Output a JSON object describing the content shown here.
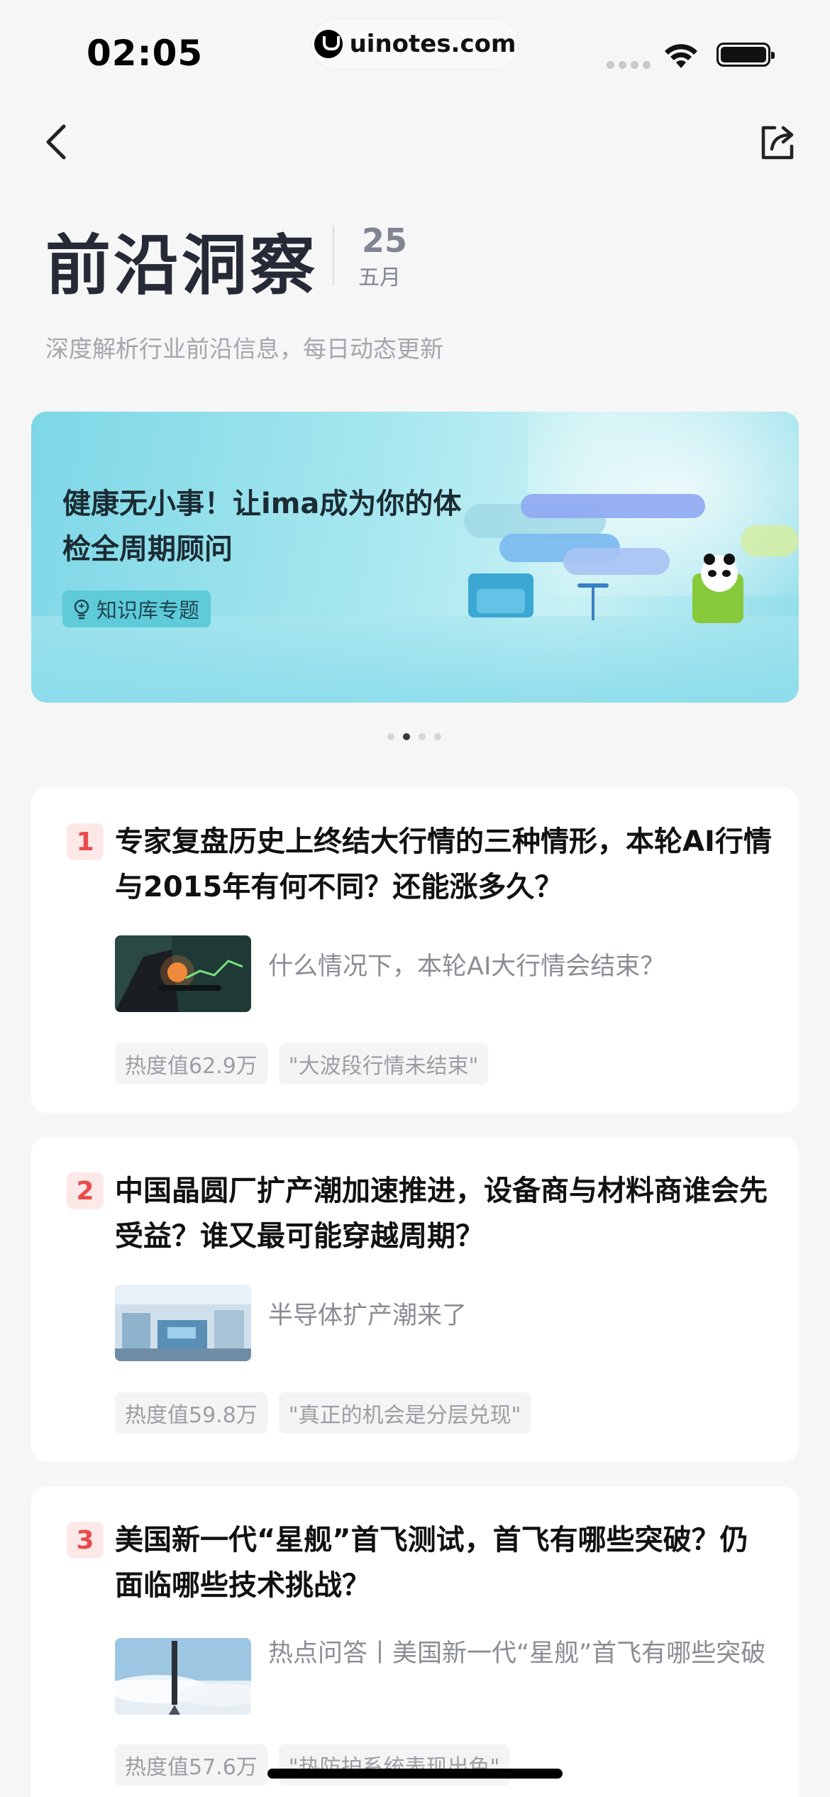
{
  "status_bar": {
    "time": "02:05",
    "url": "uinotes.com"
  },
  "nav": {
    "back_icon": "chevron-left-icon",
    "share_icon": "share-icon"
  },
  "header": {
    "title": "前沿洞察",
    "date_day": "25",
    "date_month": "五月",
    "subtitle": "深度解析行业前沿信息，每日动态更新"
  },
  "banner": {
    "title": "健康无小事！让ima成为你的体检全周期顾问",
    "tag": "知识库专题",
    "tag_icon": "lightbulb-icon",
    "colors": {
      "accent": "#5fcbd9",
      "background": "#a7e7ef"
    }
  },
  "carousel": {
    "count": 4,
    "active_index": 1
  },
  "articles": [
    {
      "rank": "1",
      "title": "专家复盘历史上终结大行情的三种情形，本轮AI行情与2015年有何不同？还能涨多久？",
      "desc": "什么情况下，本轮AI大行情会结束？",
      "heat": "热度值62.9万",
      "quote": "\"大波段行情未结束\"",
      "thumb_icon": "finance-chart-image"
    },
    {
      "rank": "2",
      "title": "中国晶圆厂扩产潮加速推进，设备商与材料商谁会先受益？谁又最可能穿越周期？",
      "desc": "半导体扩产潮来了",
      "heat": "热度值59.8万",
      "quote": "\"真正的机会是分层兑现\"",
      "thumb_icon": "factory-image"
    },
    {
      "rank": "3",
      "title": "美国新一代“星舰”首飞测试，首飞有哪些突破？仍面临哪些技术挑战？",
      "desc": "热点问答丨美国新一代“星舰”首飞有哪些突破",
      "heat": "热度值57.6万",
      "quote": "\"热防护系统表现出色\"",
      "thumb_icon": "rocket-image"
    }
  ],
  "colors": {
    "rank_text": "#e94b4b",
    "rank_bg": "#fde8e8",
    "title": "#262a36"
  }
}
